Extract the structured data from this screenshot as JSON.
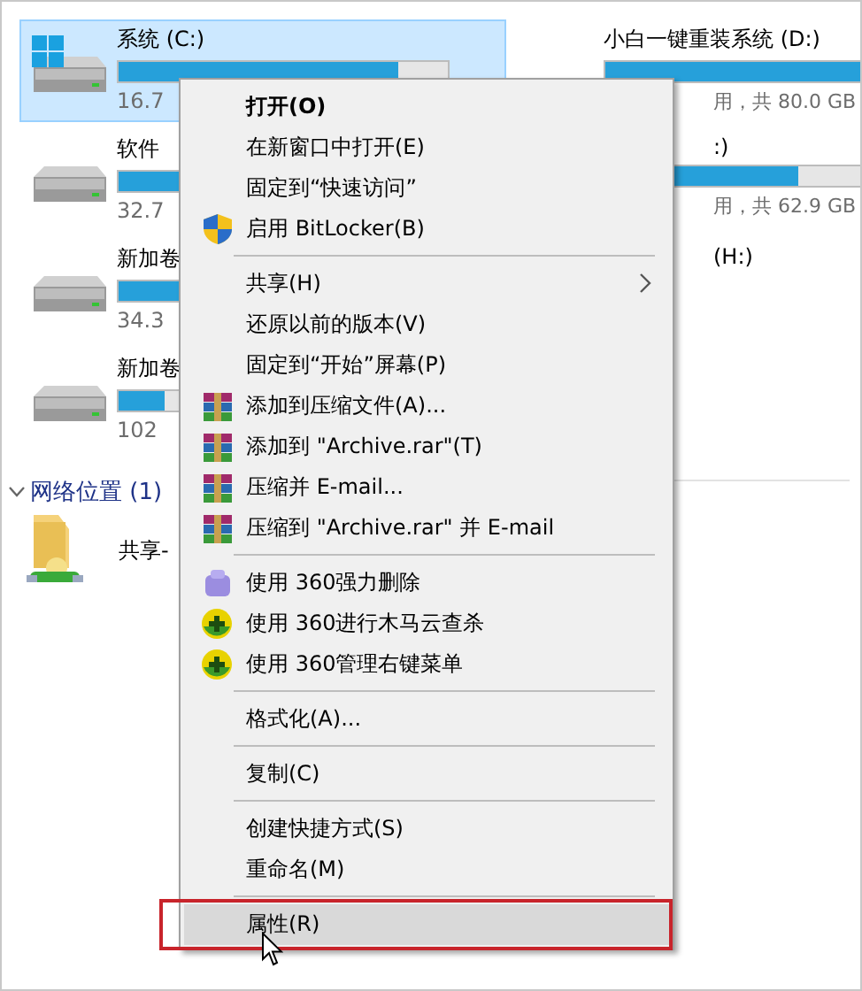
{
  "drives": [
    {
      "name": "系统 (C:)",
      "kind": "system",
      "level": 0.85,
      "reading": "16.7",
      "selected": true
    },
    {
      "name": "小白一键重装系统 (D:)",
      "level": 1.0,
      "reading": "用，共 80.0 GB",
      "selected": false
    },
    {
      "name": "软件",
      "kind": "disk",
      "level": 0.6,
      "reading": "32.7",
      "selected": false
    },
    {
      "name": ":)",
      "level": 0.69,
      "reading": "用，共 62.9 GB",
      "selected": false
    },
    {
      "name": "新加卷",
      "kind": "disk",
      "level": 0.55,
      "reading": "34.3",
      "selected": false
    },
    {
      "name": "(H:)",
      "selected": false
    },
    {
      "name": "新加卷",
      "kind": "disk",
      "level": 0.14,
      "reading": "102",
      "selected": false
    }
  ],
  "network_group": {
    "title": "网络位置 (1)",
    "expanded": true,
    "items": [
      {
        "name": "共享-"
      }
    ]
  },
  "context_menu": {
    "groups": [
      [
        {
          "label": "打开(O)",
          "kind": "default",
          "submenu": false,
          "selected": false
        },
        {
          "label": "在新窗口中打开(E)",
          "kind": "plain",
          "submenu": false,
          "selected": false
        },
        {
          "label": "固定到“快速访问”",
          "kind": "plain",
          "submenu": false,
          "selected": false
        },
        {
          "label": "启用 BitLocker(B)",
          "kind": "shield",
          "submenu": false,
          "selected": false
        }
      ],
      [
        {
          "label": "共享(H)",
          "kind": "plain",
          "submenu": true,
          "selected": false
        },
        {
          "label": "还原以前的版本(V)",
          "kind": "plain",
          "submenu": false,
          "selected": false
        },
        {
          "label": "固定到“开始”屏幕(P)",
          "kind": "plain",
          "submenu": false,
          "selected": false
        },
        {
          "label": "添加到压缩文件(A)...",
          "kind": "archive",
          "submenu": false,
          "selected": false
        },
        {
          "label": "添加到 \"Archive.rar\"(T)",
          "kind": "archive",
          "submenu": false,
          "selected": false
        },
        {
          "label": "压缩并 E-mail...",
          "kind": "archive",
          "submenu": false,
          "selected": false
        },
        {
          "label": "压缩到 \"Archive.rar\" 并 E-mail",
          "kind": "archive",
          "submenu": false,
          "selected": false
        }
      ],
      [
        {
          "label": "使用 360强力删除",
          "kind": "purple360",
          "submenu": false,
          "selected": false
        },
        {
          "label": "使用 360进行木马云查杀",
          "kind": "green360",
          "submenu": false,
          "selected": false
        },
        {
          "label": "使用 360管理右键菜单",
          "kind": "green360",
          "submenu": false,
          "selected": false
        }
      ],
      [
        {
          "label": "格式化(A)...",
          "kind": "plain",
          "submenu": false,
          "selected": false
        }
      ],
      [
        {
          "label": "复制(C)",
          "kind": "plain",
          "submenu": false,
          "selected": false
        }
      ],
      [
        {
          "label": "创建快捷方式(S)",
          "kind": "plain",
          "submenu": false,
          "selected": false
        },
        {
          "label": "重命名(M)",
          "kind": "plain",
          "submenu": false,
          "selected": false
        }
      ],
      [
        {
          "label": "属性(R)",
          "kind": "plain",
          "submenu": false,
          "selected": true
        }
      ]
    ]
  }
}
